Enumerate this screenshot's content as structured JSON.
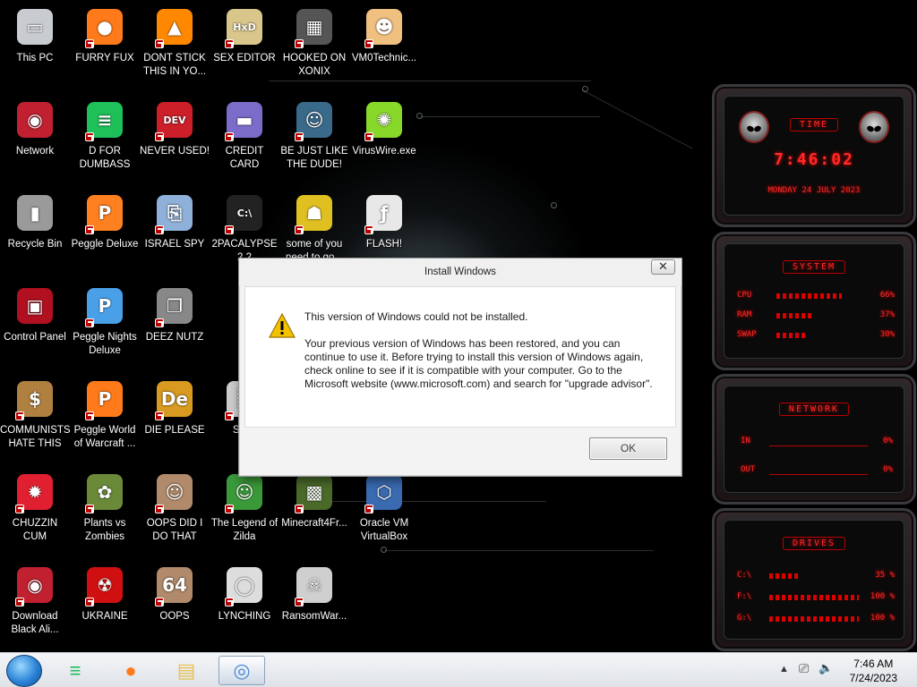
{
  "desktop_icons": [
    {
      "label": "This PC",
      "icon": "computer-icon",
      "col": 0,
      "row": 0
    },
    {
      "label": "FURRY FUX",
      "icon": "firefox-icon",
      "col": 1,
      "row": 0
    },
    {
      "label": "DONT STICK THIS IN YO...",
      "icon": "vlc-cone-icon",
      "col": 2,
      "row": 0
    },
    {
      "label": "SEX EDITOR",
      "icon": "hex-editor-icon",
      "col": 3,
      "row": 0
    },
    {
      "label": "HOOKED ON XONIX",
      "icon": "xonix-game-icon",
      "col": 4,
      "row": 0
    },
    {
      "label": "VM0Technic...",
      "icon": "doctor-icon",
      "col": 5,
      "row": 0
    },
    {
      "label": "Network",
      "icon": "alien-network-icon",
      "col": 0,
      "row": 1
    },
    {
      "label": "D FOR DUMBASS",
      "icon": "green-chat-icon",
      "col": 1,
      "row": 1
    },
    {
      "label": "NEVER USED!",
      "icon": "devcpp-icon",
      "col": 2,
      "row": 1
    },
    {
      "label": "CREDIT CARD CHECKER",
      "icon": "credit-card-icon",
      "col": 3,
      "row": 1
    },
    {
      "label": "BE JUST LIKE THE DUDE!",
      "icon": "gnome-icon",
      "col": 4,
      "row": 1
    },
    {
      "label": "VirusWire.exe",
      "icon": "lime-icon",
      "col": 5,
      "row": 1
    },
    {
      "label": "Recycle Bin",
      "icon": "recycle-bin-icon",
      "col": 0,
      "row": 2
    },
    {
      "label": "Peggle Deluxe",
      "icon": "peggle-icon",
      "col": 1,
      "row": 2
    },
    {
      "label": "ISRAEL SPY",
      "icon": "network-spy-icon",
      "col": 2,
      "row": 2
    },
    {
      "label": "2PACALYPSE 2.2",
      "icon": "terminal-icon",
      "col": 3,
      "row": 2
    },
    {
      "label": "some of you need to go...",
      "icon": "dog-icon",
      "col": 4,
      "row": 2
    },
    {
      "label": "FLASH!",
      "icon": "flash-icon",
      "col": 5,
      "row": 2
    },
    {
      "label": "Control Panel",
      "icon": "control-panel-icon",
      "col": 0,
      "row": 3
    },
    {
      "label": "Peggle Nights Deluxe",
      "icon": "peggle-nights-icon",
      "col": 1,
      "row": 3
    },
    {
      "label": "DEEZ NUTZ",
      "icon": "stacked-windows-icon",
      "col": 2,
      "row": 3
    },
    {
      "label": "COMMUNISTS HATE THIS G...",
      "icon": "money-bag-icon",
      "col": 0,
      "row": 4
    },
    {
      "label": "Peggle World of Warcraft ...",
      "icon": "peggle-wow-icon",
      "col": 1,
      "row": 4
    },
    {
      "label": "DIE PLEASE",
      "icon": "de-icon",
      "col": 2,
      "row": 4
    },
    {
      "label": "Sups",
      "icon": "partial-icon",
      "col": 3,
      "row": 4
    },
    {
      "label": "CHUZZIN CUM",
      "icon": "chuzzle-icon",
      "col": 0,
      "row": 5
    },
    {
      "label": "Plants vs Zombies",
      "icon": "plants-vs-zombies-icon",
      "col": 1,
      "row": 5
    },
    {
      "label": "OOPS DID I DO THAT",
      "icon": "portrait-icon",
      "col": 2,
      "row": 5
    },
    {
      "label": "The Legend of Zilda",
      "icon": "zelda-icon",
      "col": 3,
      "row": 5
    },
    {
      "label": "Minecraft4Fr...",
      "icon": "minecraft-icon",
      "col": 4,
      "row": 5
    },
    {
      "label": "Oracle VM VirtualBox",
      "icon": "virtualbox-icon",
      "col": 5,
      "row": 5
    },
    {
      "label": "Download Black Ali...",
      "icon": "alien-download-icon",
      "col": 0,
      "row": 6
    },
    {
      "label": "UKRAINE",
      "icon": "radiation-icon",
      "col": 1,
      "row": 6
    },
    {
      "label": "OOPS",
      "icon": "portrait-64-icon",
      "col": 2,
      "row": 6
    },
    {
      "label": "LYNCHING",
      "icon": "noose-icon",
      "col": 3,
      "row": 6
    },
    {
      "label": "RansomWar...",
      "icon": "skull-icon",
      "col": 4,
      "row": 6
    }
  ],
  "icon_colors": {
    "computer-icon": "#c8ccd0",
    "firefox-icon": "#ff7a1a",
    "vlc-cone-icon": "#ff8800",
    "hex-editor-icon": "#d8c68a",
    "xonix-game-icon": "#555555",
    "doctor-icon": "#f0c080",
    "alien-network-icon": "#c02030",
    "green-chat-icon": "#1fbf5a",
    "devcpp-icon": "#cc1f2a",
    "credit-card-icon": "#7a6cc8",
    "gnome-icon": "#3a6a8a",
    "lime-icon": "#88d82a",
    "recycle-bin-icon": "#9a9a9a",
    "peggle-icon": "#ff8020",
    "network-spy-icon": "#8fb0d8",
    "terminal-icon": "#222222",
    "dog-icon": "#e0c020",
    "flash-icon": "#e8e8e8",
    "control-panel-icon": "#b01020",
    "peggle-nights-icon": "#4aa0e8",
    "stacked-windows-icon": "#888888",
    "money-bag-icon": "#b08040",
    "peggle-wow-icon": "#ff7a1a",
    "de-icon": "#d89a20",
    "partial-icon": "#cccccc",
    "chuzzle-icon": "#e02030",
    "plants-vs-zombies-icon": "#6a8a3a",
    "portrait-icon": "#b08a6a",
    "zelda-icon": "#3a9a3a",
    "minecraft-icon": "#4a6a2a",
    "virtualbox-icon": "#3a6ab0",
    "alien-download-icon": "#c02030",
    "radiation-icon": "#d01010",
    "portrait-64-icon": "#b08a6a",
    "noose-icon": "#dddddd",
    "skull-icon": "#cfcfcf"
  },
  "icon_glyphs": {
    "computer-icon": "▭",
    "firefox-icon": "●",
    "vlc-cone-icon": "▲",
    "hex-editor-icon": "HxD",
    "xonix-game-icon": "▦",
    "doctor-icon": "☻",
    "alien-network-icon": "◉",
    "green-chat-icon": "≡",
    "devcpp-icon": "DEV",
    "credit-card-icon": "▬",
    "gnome-icon": "☺",
    "lime-icon": "✺",
    "recycle-bin-icon": "▮",
    "peggle-icon": "P",
    "network-spy-icon": "⎘",
    "terminal-icon": "C:\\",
    "dog-icon": "☗",
    "flash-icon": "ƒ",
    "control-panel-icon": "▣",
    "peggle-nights-icon": "P",
    "stacked-windows-icon": "❐",
    "money-bag-icon": "$",
    "peggle-wow-icon": "P",
    "de-icon": "De",
    "partial-icon": "▒",
    "chuzzle-icon": "✹",
    "plants-vs-zombies-icon": "✿",
    "portrait-icon": "☺",
    "zelda-icon": "☺",
    "minecraft-icon": "▩",
    "virtualbox-icon": "⬡",
    "alien-download-icon": "◉",
    "radiation-icon": "☢",
    "portrait-64-icon": "64",
    "noose-icon": "◯",
    "skull-icon": "☠"
  },
  "dialog": {
    "title": "Install Windows",
    "close_glyph": "✕",
    "main_message": "This version of Windows could not be installed.",
    "body": "Your previous version of Windows has been restored, and you can continue to use it.  Before trying to install this version of Windows again, check online to see if it is compatible with your computer.  Go to the Microsoft website (www.microsoft.com) and search for \"upgrade advisor\".",
    "ok_label": "OK",
    "warning_color": "#f2c200"
  },
  "gadgets": {
    "time": {
      "title": "TIME",
      "time": "7:46:02",
      "date": "MONDAY 24 JULY 2023"
    },
    "system": {
      "title": "SYSTEM",
      "rows": [
        {
          "label": "CPU",
          "value": "66%",
          "fill": 0.66
        },
        {
          "label": "RAM",
          "value": "37%",
          "fill": 0.37
        },
        {
          "label": "SWAP",
          "value": "30%",
          "fill": 0.3
        }
      ]
    },
    "network": {
      "title": "NETWORK",
      "rows": [
        {
          "label": "IN",
          "value": "0%"
        },
        {
          "label": "OUT",
          "value": "0%"
        }
      ]
    },
    "drives": {
      "title": "DRIVES",
      "rows": [
        {
          "label": "C:\\",
          "value": "35 %",
          "fill": 0.35
        },
        {
          "label": "F:\\",
          "value": "100 %",
          "fill": 1.0
        },
        {
          "label": "G:\\",
          "value": "100 %",
          "fill": 1.0
        }
      ]
    },
    "accent": "#ff2a2a"
  },
  "taskbar": {
    "items": [
      {
        "name": "taskbar-chat-app",
        "icon": "green-chat-icon",
        "glyph": "≡",
        "color": "#1fbf5a",
        "active": false
      },
      {
        "name": "taskbar-firefox",
        "icon": "firefox-icon",
        "glyph": "●",
        "color": "#ff7a1a",
        "active": false
      },
      {
        "name": "taskbar-file-explorer",
        "icon": "folder-icon",
        "glyph": "▤",
        "color": "#e8c050",
        "active": false
      },
      {
        "name": "taskbar-windows-setup",
        "icon": "setup-disc-icon",
        "glyph": "◎",
        "color": "#4a8ad8",
        "active": true
      }
    ],
    "tray": {
      "show_hidden_glyph": "▲",
      "network_glyph": "⎚",
      "volume_glyph": "🔈"
    },
    "clock": {
      "time": "7:46 AM",
      "date": "7/24/2023"
    }
  }
}
